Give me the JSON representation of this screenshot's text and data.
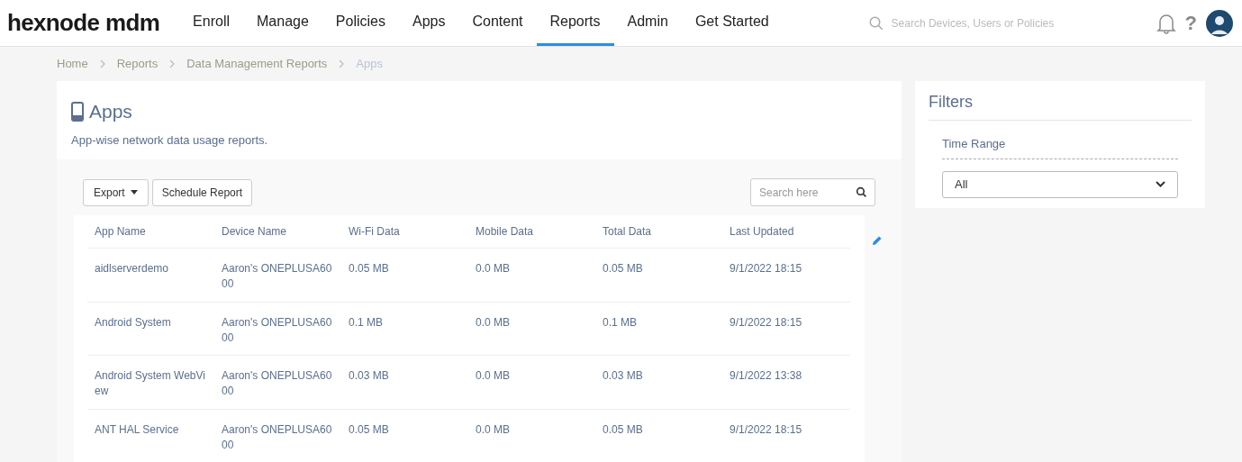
{
  "logo": "hexnode mdm",
  "nav": [
    {
      "label": "Enroll",
      "selected": false
    },
    {
      "label": "Manage",
      "selected": false
    },
    {
      "label": "Policies",
      "selected": false
    },
    {
      "label": "Apps",
      "selected": false
    },
    {
      "label": "Content",
      "selected": false
    },
    {
      "label": "Reports",
      "selected": true
    },
    {
      "label": "Admin",
      "selected": false
    },
    {
      "label": "Get Started",
      "selected": false
    }
  ],
  "global_search": {
    "placeholder": "Search Devices, Users or Policies"
  },
  "help": "?",
  "breadcrumb": [
    {
      "label": "Home",
      "current": false
    },
    {
      "label": "Reports",
      "current": false
    },
    {
      "label": "Data Management Reports",
      "current": false
    },
    {
      "label": "Apps",
      "current": true
    }
  ],
  "page": {
    "title": "Apps",
    "subtitle": "App-wise network data usage reports."
  },
  "toolbar": {
    "export": "Export",
    "schedule": "Schedule Report",
    "search_placeholder": "Search here"
  },
  "table": {
    "columns": [
      "App Name",
      "Device Name",
      "Wi-Fi Data",
      "Mobile Data",
      "Total Data",
      "Last Updated"
    ],
    "rows": [
      [
        "aidlserverdemo",
        "Aaron's ONEPLUSA6000",
        "0.05 MB",
        "0.0 MB",
        "0.05 MB",
        "9/1/2022 18:15"
      ],
      [
        "Android System",
        "Aaron's ONEPLUSA6000",
        "0.1 MB",
        "0.0 MB",
        "0.1 MB",
        "9/1/2022 18:15"
      ],
      [
        "Android System WebView",
        "Aaron's ONEPLUSA6000",
        "0.03 MB",
        "0.0 MB",
        "0.03 MB",
        "9/1/2022 13:38"
      ],
      [
        "ANT HAL Service",
        "Aaron's ONEPLUSA6000",
        "0.05 MB",
        "0.0 MB",
        "0.05 MB",
        "9/1/2022 18:15"
      ]
    ]
  },
  "filters": {
    "title": "Filters",
    "time_range_label": "Time Range",
    "time_range_value": "All"
  }
}
